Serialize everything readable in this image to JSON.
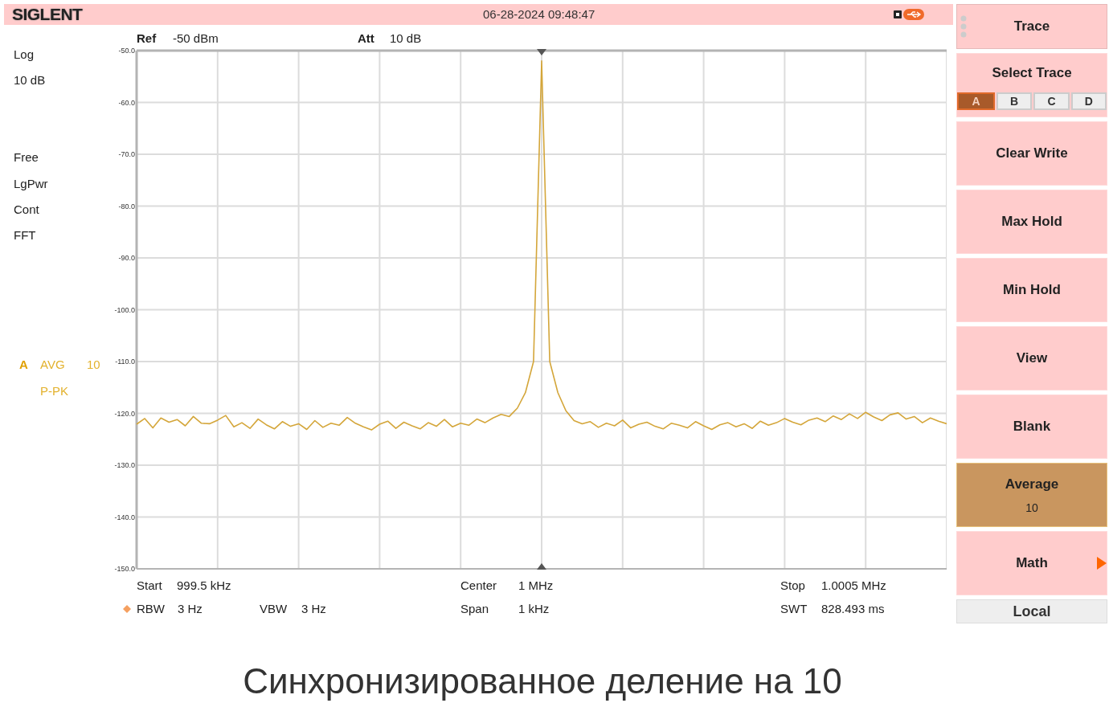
{
  "header": {
    "brand": "SIGLENT",
    "datetime": "06-28-2024 09:48:47"
  },
  "settings_bar": [
    {
      "label": "Ref",
      "value": "-50 dBm"
    },
    {
      "label": "Att",
      "value": "10 dB"
    }
  ],
  "left_panel": {
    "scale": [
      "Log",
      "10 dB"
    ],
    "modes": [
      "Free",
      "LgPwr",
      "Cont",
      "FFT"
    ]
  },
  "trace_info": {
    "trace": "A",
    "mode": "AVG",
    "count": "10",
    "detector": "P-PK"
  },
  "chart_data": {
    "type": "line",
    "categories": [
      null,
      null,
      null,
      null,
      null,
      null,
      null,
      null,
      null,
      null,
      null,
      null,
      null,
      null,
      null,
      null,
      null,
      null,
      null,
      null,
      null,
      null,
      null,
      null,
      null,
      null,
      null,
      null,
      null,
      null,
      null,
      null,
      null,
      null,
      null,
      null,
      null,
      null,
      null,
      null,
      null,
      null,
      null,
      null,
      null,
      null,
      null,
      null,
      null,
      null,
      null,
      null,
      null,
      null,
      null,
      null,
      null,
      null,
      null,
      null,
      null,
      null,
      null,
      null,
      null,
      null,
      null,
      null,
      null,
      null,
      null,
      null,
      null,
      null,
      null,
      null,
      null,
      null,
      null,
      null,
      null,
      null,
      null,
      null,
      null,
      null,
      null,
      null,
      null,
      null,
      null,
      null,
      null,
      null,
      null,
      null,
      null,
      null,
      null,
      null,
      null
    ],
    "series": [
      {
        "color": "#d4a63a",
        "values": [
          -122.1,
          -121.0,
          -122.8,
          -120.9,
          -121.7,
          -121.2,
          -122.4,
          -120.6,
          -121.9,
          -122.0,
          -121.3,
          -120.4,
          -122.6,
          -121.8,
          -122.9,
          -121.1,
          -122.2,
          -123.0,
          -121.6,
          -122.5,
          -122.0,
          -123.1,
          -121.4,
          -122.7,
          -121.9,
          -122.3,
          -120.8,
          -121.9,
          -122.6,
          -123.2,
          -122.1,
          -121.5,
          -122.9,
          -121.7,
          -122.4,
          -123.0,
          -121.8,
          -122.5,
          -121.2,
          -122.6,
          -121.9,
          -122.3,
          -121.1,
          -121.8,
          -120.9,
          -120.2,
          -120.6,
          -119.0,
          -116.0,
          -110.0,
          -52.0,
          -110.0,
          -116.0,
          -119.5,
          -121.4,
          -122.0,
          -121.6,
          -122.7,
          -121.9,
          -122.4,
          -121.3,
          -122.8,
          -122.1,
          -121.7,
          -122.5,
          -123.0,
          -121.9,
          -122.3,
          -122.8,
          -121.6,
          -122.4,
          -123.1,
          -122.2,
          -121.8,
          -122.6,
          -122.0,
          -122.9,
          -121.5,
          -122.3,
          -121.8,
          -121.0,
          -121.7,
          -122.2,
          -121.3,
          -120.9,
          -121.6,
          -120.5,
          -121.2,
          -120.1,
          -121.0,
          -119.8,
          -120.7,
          -121.4,
          -120.3,
          -119.9,
          -121.1,
          -120.6,
          -121.8,
          -120.9,
          -121.5,
          -122.0
        ]
      }
    ],
    "ylim": [
      -150,
      -50
    ],
    "yticks": [
      {
        "value": -50,
        "label": "-50.0"
      },
      {
        "value": -60,
        "label": "-60.0"
      },
      {
        "value": -70,
        "label": "-70.0"
      },
      {
        "value": -80,
        "label": "-80.0"
      },
      {
        "value": -90,
        "label": "-90.0"
      },
      {
        "value": -100,
        "label": "-100.0"
      },
      {
        "value": -110,
        "label": "-110.0"
      },
      {
        "value": -120,
        "label": "-120.0"
      },
      {
        "value": -130,
        "label": "-130.0"
      },
      {
        "value": -140,
        "label": "-140.0"
      },
      {
        "value": -150,
        "label": "-150.0"
      }
    ],
    "grid": true
  },
  "footer": {
    "start": {
      "label": "Start",
      "value": "999.5 kHz"
    },
    "center": {
      "label": "Center",
      "value": "1 MHz"
    },
    "stop": {
      "label": "Stop",
      "value": "1.0005 MHz"
    },
    "rbw": {
      "label": "RBW",
      "value": "3 Hz"
    },
    "vbw": {
      "label": "VBW",
      "value": "3 Hz"
    },
    "span": {
      "label": "Span",
      "value": "1 kHz"
    },
    "swt": {
      "label": "SWT",
      "value": "828.493 ms"
    }
  },
  "softkeys": {
    "title": "Trace",
    "items": [
      {
        "kind": "selector",
        "label": "Select Trace",
        "selected": false,
        "options": [
          {
            "label": "A",
            "selected": true
          },
          {
            "label": "B",
            "selected": false
          },
          {
            "label": "C",
            "selected": false
          },
          {
            "label": "D",
            "selected": false
          }
        ]
      },
      {
        "kind": "button",
        "label": "Clear Write",
        "selected": false
      },
      {
        "kind": "button",
        "label": "Max Hold",
        "selected": false
      },
      {
        "kind": "button",
        "label": "Min Hold",
        "selected": false
      },
      {
        "kind": "button",
        "label": "View",
        "selected": false
      },
      {
        "kind": "button",
        "label": "Blank",
        "selected": false
      },
      {
        "kind": "button",
        "label": "Average",
        "value": "10",
        "selected": true
      },
      {
        "kind": "submenu",
        "label": "Math",
        "selected": false
      }
    ],
    "status": "Local"
  },
  "caption": "Синхронизированное деление на 10"
}
